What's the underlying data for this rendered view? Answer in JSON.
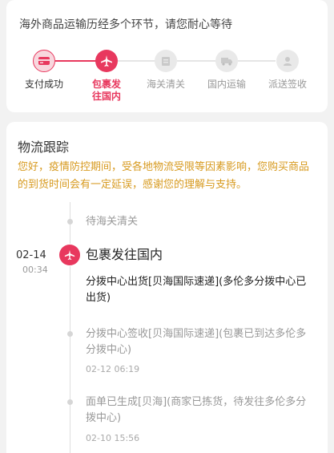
{
  "progress": {
    "note": "海外商品运输历经多个环节，请您耐心等待",
    "steps": [
      {
        "label": "支付成功",
        "icon": "card-icon",
        "state": "done"
      },
      {
        "label": "包裹发往国内",
        "icon": "plane-icon",
        "state": "active"
      },
      {
        "label": "海关清关",
        "icon": "customs-icon",
        "state": "pending"
      },
      {
        "label": "国内运输",
        "icon": "truck-icon",
        "state": "pending"
      },
      {
        "label": "派送签收",
        "icon": "courier-icon",
        "state": "pending"
      }
    ]
  },
  "tracking": {
    "title": "物流跟踪",
    "notice": "您好，疫情防控期间，受各地物流受限等因素影响，您购买商品的到货时间会有一定延误，感谢您的理解与支持。",
    "events": [
      {
        "status": "待海关清关"
      },
      {
        "date": "02-14",
        "clock": "00:34",
        "status": "包裹发往国内",
        "detail": "分拨中心出货[贝海国际速递](多伦多分拨中心已出货)"
      },
      {
        "detail": "分拨中心签收[贝海国际速递](包裹已到达多伦多分拨中心)",
        "time": "02-12 06:19"
      },
      {
        "detail": "面单已生成[贝海](商家已拣货，待发往多伦多分拨中心)",
        "time": "02-10 15:56"
      }
    ]
  },
  "colors": {
    "accent": "#e8385e",
    "notice": "#d79a1f"
  }
}
